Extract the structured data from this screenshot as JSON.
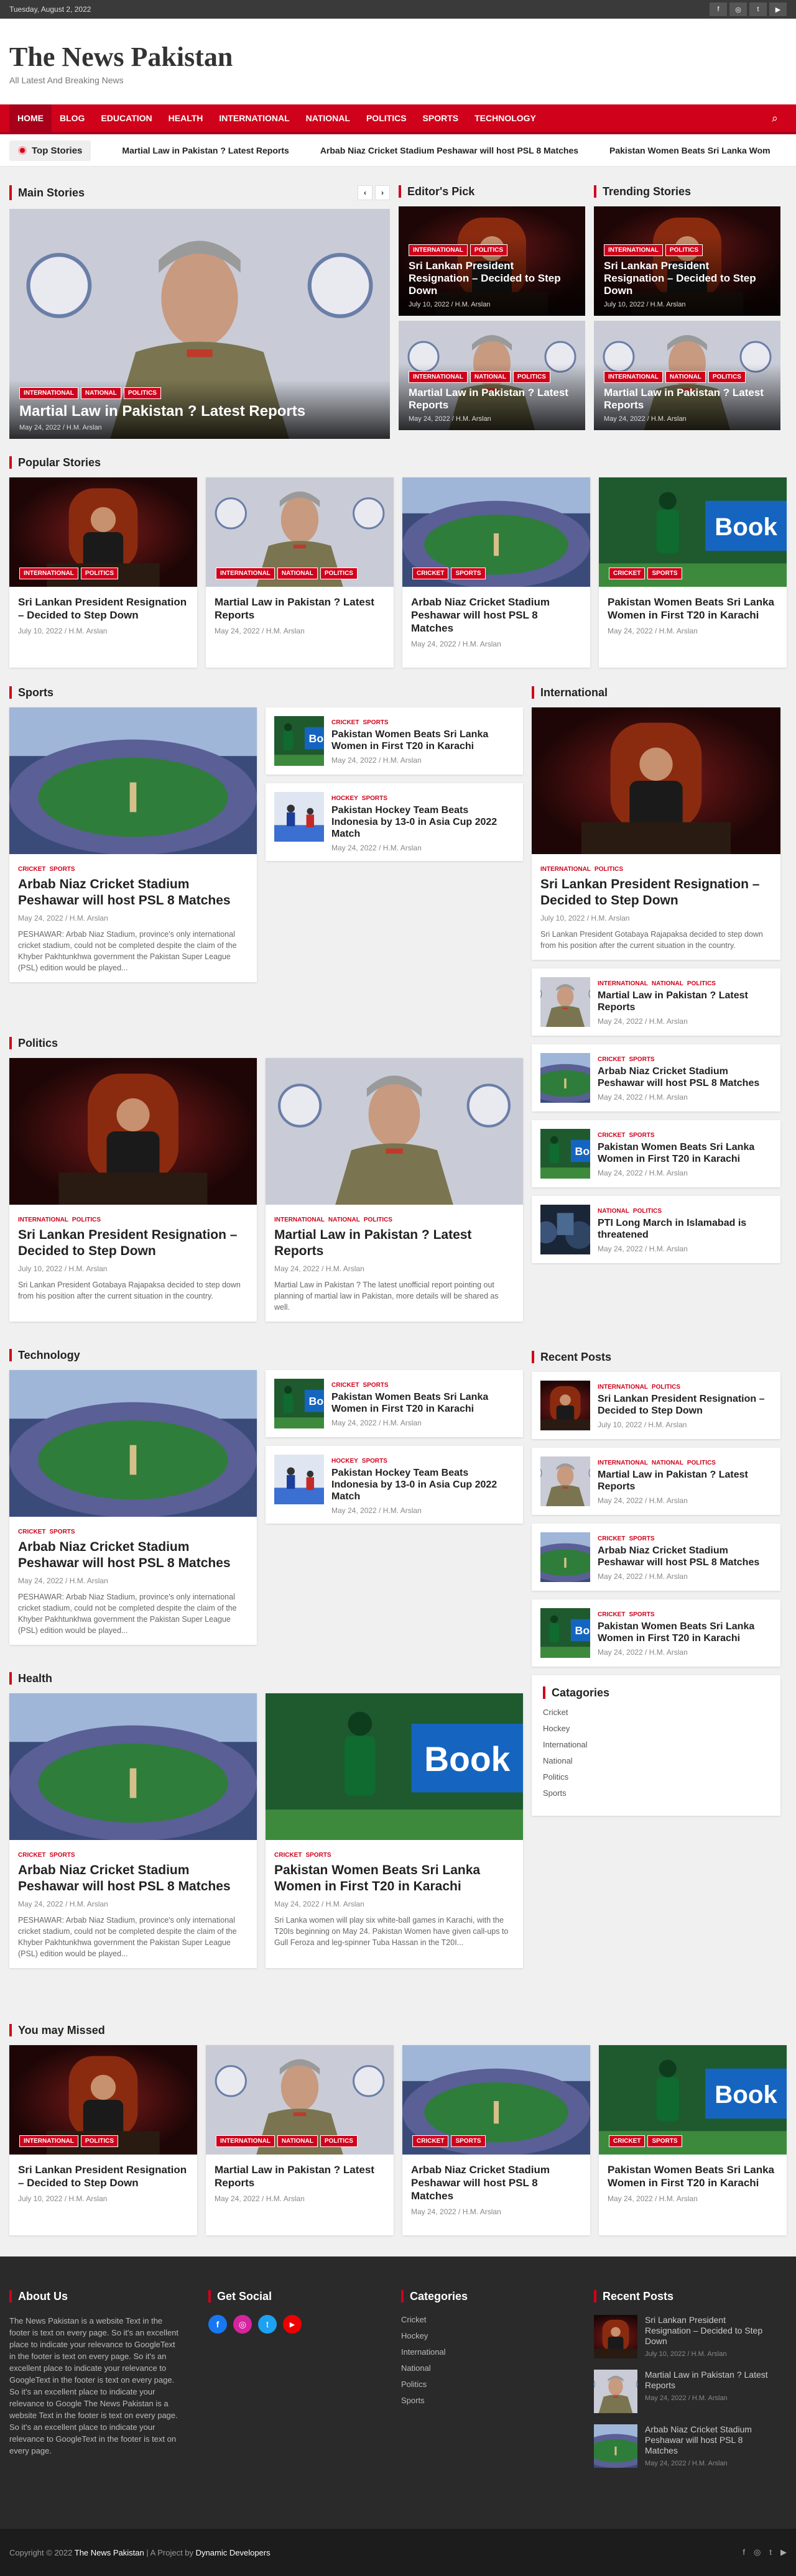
{
  "topbar": {
    "date": "Tuesday, August 2, 2022",
    "social": [
      "f",
      "◎",
      "t",
      "▶"
    ]
  },
  "header": {
    "title": "The News Pakistan",
    "tagline": "All Latest And Breaking News"
  },
  "nav": {
    "items": [
      "HOME",
      "BLOG",
      "EDUCATION",
      "HEALTH",
      "INTERNATIONAL",
      "NATIONAL",
      "POLITICS",
      "SPORTS",
      "TECHNOLOGY"
    ],
    "search_icon": "⌕"
  },
  "ticker": {
    "label": "Top Stories",
    "items": [
      "Martial Law in Pakistan ? Latest Reports",
      "Arbab Niaz Cricket Stadium Peshawar will host PSL 8 Matches",
      "Pakistan Women Beats Sri Lanka Wom"
    ]
  },
  "sections": {
    "main": "Main Stories",
    "editors": "Editor's Pick",
    "trending": "Trending Stories",
    "popular": "Popular Stories",
    "sports": "Sports",
    "international": "International",
    "politics": "Politics",
    "technology": "Technology",
    "recent": "Recent Posts",
    "health": "Health",
    "categories": "Catagories",
    "missed": "You may Missed"
  },
  "arrows": {
    "prev": "‹",
    "next": "›"
  },
  "posts": {
    "lanka": {
      "title": "Sri Lankan President Resignation – Decided to Step Down",
      "date": "July 10, 2022",
      "author": "H.M. Arslan",
      "tags": [
        "International",
        "Politics"
      ],
      "excerpt": "Sri Lankan President Gotabaya Rajapaksa decided to step down from his position after the current situation in the country."
    },
    "martial": {
      "title": "Martial Law in Pakistan ? Latest Reports",
      "date": "May 24, 2022",
      "author": "H.M. Arslan",
      "tags": [
        "International",
        "National",
        "Politics"
      ],
      "excerpt": "Martial Law in Pakistan ? The latest unofficial report pointing out planning of martial law in Pakistan, more details will be shared as well."
    },
    "stadium": {
      "title": "Arbab Niaz Cricket Stadium Peshawar will host PSL 8 Matches",
      "date": "May 24, 2022",
      "author": "H.M. Arslan",
      "tags": [
        "Cricket",
        "Sports"
      ],
      "excerpt": "PESHAWAR: Arbab Niaz Stadium, province's only international cricket stadium, could not be completed despite the claim of the Khyber Pakhtunkhwa government the Pakistan Super League (PSL) edition would be played..."
    },
    "women": {
      "title": "Pakistan Women Beats Sri Lanka Women in First T20 in Karachi",
      "date": "May 24, 2022",
      "author": "H.M. Arslan",
      "tags": [
        "Cricket",
        "Sports"
      ],
      "excerpt": "Sri Lanka women will play six white-ball games in Karachi, with the T20Is beginning on May 24. Pakistan Women have given call-ups to Gull Feroza and leg-spinner Tuba Hassan in the T20I..."
    },
    "hockey": {
      "title": "Pakistan Hockey Team Beats Indonesia by 13-0 in Asia Cup 2022 Match",
      "date": "May 24, 2022",
      "author": "H.M. Arslan",
      "tags": [
        "Hockey",
        "Sports"
      ]
    },
    "march": {
      "title": "PTI Long March in Islamabad is threatened",
      "date": "May 24, 2022",
      "author": "H.M. Arslan",
      "tags": [
        "National",
        "Politics"
      ]
    }
  },
  "categories": [
    "Cricket",
    "Hockey",
    "International",
    "National",
    "Politics",
    "Sports"
  ],
  "footer": {
    "about_title": "About Us",
    "about_text": "The News Pakistan is a website Text in the footer is text on every page. So it's an excellent place to indicate your relevance to GoogleText in the footer is text on every page. So it's an excellent place to indicate your relevance to GoogleText in the footer is text on every page. So it's an excellent place to indicate your relevance to Google The News Pakistan is a website Text in the footer is text on every page. So it's an excellent place to indicate your relevance to GoogleText in the footer is text on every page.",
    "social_title": "Get Social",
    "social": [
      "f",
      "◎",
      "t",
      "▶"
    ],
    "cat_title": "Categories",
    "recent_title": "Recent Posts"
  },
  "copyright": {
    "prefix": "Copyright © 2022",
    "site": "The News Pakistan",
    "sep": "|",
    "by": "A Project by",
    "dev": "Dynamic Developers"
  },
  "colors": {
    "accent": "#d0021b",
    "topbar": "#3a3a3a",
    "footer": "#2a2a2a"
  }
}
